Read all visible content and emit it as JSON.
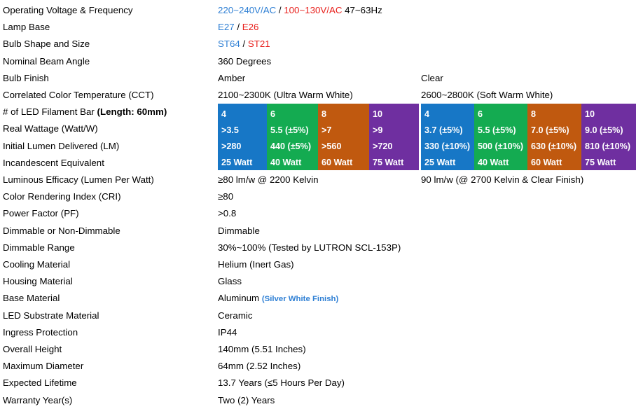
{
  "spec_table": {
    "rows": [
      {
        "label": "Operating Voltage &amp; Frequency",
        "value_parts": [
          {
            "text": "220~240V/AC",
            "color": "blue"
          },
          {
            "text": " / ",
            "color": "black"
          },
          {
            "text": "100~130V/AC",
            "color": "red"
          },
          {
            "text": " 47~63Hz",
            "color": "black"
          }
        ]
      },
      {
        "label": "Lamp Base",
        "value_parts": [
          {
            "text": "E27",
            "color": "blue"
          },
          {
            "text": " / ",
            "color": "black"
          },
          {
            "text": "E26",
            "color": "red"
          }
        ]
      },
      {
        "label": "Bulb Shape and Size",
        "value_parts": [
          {
            "text": "ST64",
            "color": "blue"
          },
          {
            "text": " / ",
            "color": "black"
          },
          {
            "text": "ST21",
            "color": "red"
          }
        ]
      },
      {
        "label": "Nominal Beam Angle",
        "value_parts": [
          {
            "text": "360 Degrees",
            "color": "black"
          }
        ]
      },
      {
        "label": "Bulb Finish",
        "value_parts": [
          {
            "text": "Amber",
            "color": "black"
          }
        ],
        "value2_parts": [
          {
            "text": "Clear",
            "color": "black"
          }
        ]
      },
      {
        "label": "Correlated Color Temperature (CCT)",
        "value_parts": [
          {
            "text": "2100~2300K (Ultra Warm White)",
            "color": "black"
          }
        ],
        "value2_parts": [
          {
            "text": "2600~2800K (Soft Warm White)",
            "color": "black"
          }
        ]
      },
      {
        "label_parts": [
          {
            "text": "# of LED Filament Bar ",
            "bold": false
          },
          {
            "text": "(Length: 60mm)",
            "bold": true
          }
        ],
        "label": "# of LED Filament Bar (Length: 60mm)",
        "value_parts": []
      },
      {
        "label": "Real Wattage (Watt/W)",
        "value_parts": []
      },
      {
        "label": "Initial Lumen Delivered (LM)",
        "value_parts": []
      },
      {
        "label": "Incandescent Equivalent",
        "value_parts": []
      },
      {
        "label": "Luminous Efficacy (Lumen Per Watt)",
        "value_parts": [
          {
            "text": "≥80 lm/w @ 2200 Kelvin",
            "color": "black"
          }
        ],
        "value2_parts": [
          {
            "text": "90 lm/w (@ 2700 Kelvin &amp; Clear Finish)",
            "color": "black"
          }
        ]
      },
      {
        "label": "Color Rendering Index (CRI)",
        "value_parts": [
          {
            "text": "≥80",
            "color": "black"
          }
        ]
      },
      {
        "label": "Power Factor (PF)",
        "value_parts": [
          {
            "text": "&gt;0.8",
            "color": "black"
          }
        ]
      },
      {
        "label": "Dimmable or Non-Dimmable",
        "value_parts": [
          {
            "text": "Dimmable",
            "color": "black"
          }
        ]
      },
      {
        "label": "Dimmable Range",
        "value_parts": [
          {
            "text": "30%~100% (Tested by LUTRON SCL-153P)",
            "color": "black"
          }
        ]
      },
      {
        "label": "Cooling Material",
        "value_parts": [
          {
            "text": "Helium (Inert Gas)",
            "color": "black"
          }
        ]
      },
      {
        "label": "Housing Material",
        "value_parts": [
          {
            "text": "Glass",
            "color": "black"
          }
        ]
      },
      {
        "label": "Base Material",
        "value_parts": [
          {
            "text": "Aluminum ",
            "color": "black"
          },
          {
            "text": "(Silver White Finish)",
            "color": "note-blue"
          }
        ]
      },
      {
        "label": "LED Substrate Material",
        "value_parts": [
          {
            "text": "Ceramic",
            "color": "black"
          }
        ]
      },
      {
        "label": "Ingress Protection",
        "value_parts": [
          {
            "text": "IP44",
            "color": "black"
          }
        ]
      },
      {
        "label": "Overall Height",
        "value_parts": [
          {
            "text": "140mm (5.51 Inches)",
            "color": "black"
          }
        ]
      },
      {
        "label": "Maximum Diameter",
        "value_parts": [
          {
            "text": "64mm (2.52 Inches)",
            "color": "black"
          }
        ]
      },
      {
        "label": "Expected Lifetime",
        "value_parts": [
          {
            "text": "13.7 Years (≤5 Hours Per Day)",
            "color": "black"
          }
        ]
      },
      {
        "label": "Warranty Year(s)",
        "value_parts": [
          {
            "text": "Two (2) Years",
            "color": "black"
          }
        ]
      }
    ]
  },
  "chart_data": {
    "type": "table",
    "title": "LED Filament Bar Performance Matrix",
    "row_labels": [
      "# of LED Filament Bar (Length: 60mm)",
      "Real Wattage (Watt/W)",
      "Initial Lumen Delivered (LM)",
      "Incandescent Equivalent"
    ],
    "matrices": [
      {
        "name": "amber",
        "finish": "Amber",
        "cct": "2100~2300K (Ultra Warm White)",
        "efficacy": "≥80 lm/w @ 2200 Kelvin",
        "columns": [
          {
            "color": "#1777c6",
            "color_name": "blue",
            "filament_bars": "4",
            "real_wattage": "&gt;3.5",
            "initial_lumen": "&gt;280",
            "incandescent_equivalent": "25 Watt"
          },
          {
            "color": "#14ab51",
            "color_name": "green",
            "filament_bars": "6",
            "real_wattage": "5.5 (±5%)",
            "initial_lumen": "440 (±5%)",
            "incandescent_equivalent": "40 Watt"
          },
          {
            "color": "#c0590f",
            "color_name": "orange",
            "filament_bars": "8",
            "real_wattage": "&gt;7",
            "initial_lumen": "&gt;560",
            "incandescent_equivalent": "60 Watt"
          },
          {
            "color": "#6f2fa0",
            "color_name": "purple",
            "filament_bars": "10",
            "real_wattage": "&gt;9",
            "initial_lumen": "&gt;720",
            "incandescent_equivalent": "75 Watt"
          }
        ]
      },
      {
        "name": "clear",
        "finish": "Clear",
        "cct": "2600~2800K (Soft Warm White)",
        "efficacy": "90 lm/w (@ 2700 Kelvin &amp; Clear Finish)",
        "columns": [
          {
            "color": "#1777c6",
            "color_name": "blue",
            "filament_bars": "4",
            "real_wattage": "3.7 (±5%)",
            "initial_lumen": "330 (±10%)",
            "incandescent_equivalent": "25 Watt"
          },
          {
            "color": "#14ab51",
            "color_name": "green",
            "filament_bars": "6",
            "real_wattage": "5.5 (±5%)",
            "initial_lumen": "500 (±10%)",
            "incandescent_equivalent": "40 Watt"
          },
          {
            "color": "#c0590f",
            "color_name": "orange",
            "filament_bars": "8",
            "real_wattage": "7.0 (±5%)",
            "initial_lumen": "630 (±10%)",
            "incandescent_equivalent": "60 Watt"
          },
          {
            "color": "#6f2fa0",
            "color_name": "purple",
            "filament_bars": "10",
            "real_wattage": "9.0 (±5%)",
            "initial_lumen": "810 (±10%)",
            "incandescent_equivalent": "75 Watt"
          }
        ]
      }
    ]
  },
  "colors": {
    "blue_text": "#2e7fd4",
    "red_text": "#e8201c",
    "cell_blue": "#1777c6",
    "cell_green": "#14ab51",
    "cell_orange": "#c0590f",
    "cell_purple": "#6f2fa0"
  }
}
